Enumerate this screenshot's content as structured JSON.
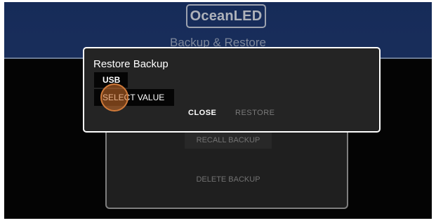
{
  "header": {
    "logo_text": "OceanLED",
    "title": "Backup & Restore"
  },
  "panel": {
    "recall_label": "RECALL BACKUP",
    "delete_label": "DELETE BACKUP"
  },
  "dialog": {
    "title": "Restore Backup",
    "source_chip": "USB",
    "select_value": "SELECT VALUE",
    "close_label": "CLOSE",
    "restore_label": "RESTORE"
  },
  "colors": {
    "header_blue": "#1e3a76",
    "touch_indicator": "#d07a3a"
  }
}
